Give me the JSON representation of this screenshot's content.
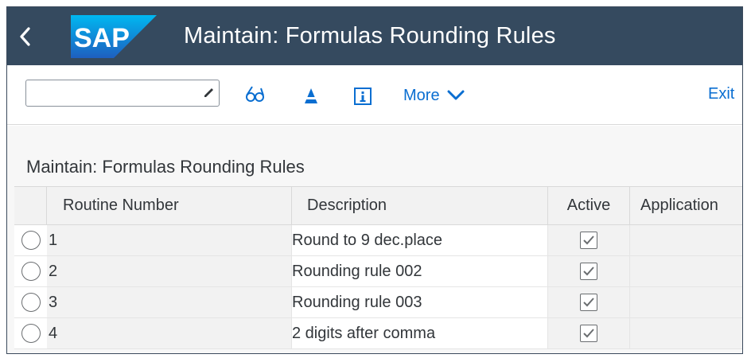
{
  "shell": {
    "title": "Maintain: Formulas Rounding Rules",
    "logo_text": "SAP",
    "back_icon": "chevron-left-icon",
    "colors": {
      "header_bg": "#354a5f",
      "logo_blue": "#1b9ae0"
    }
  },
  "toolbar": {
    "command_field": {
      "value": "",
      "placeholder": ""
    },
    "icons": [
      "glasses-display-icon",
      "triangle-cone-icon",
      "info-icon"
    ],
    "more_label": "More",
    "exit_label": "Exit",
    "accent": "#0a6ed1"
  },
  "section": {
    "title": "Maintain: Formulas Rounding Rules"
  },
  "table": {
    "columns": [
      "Routine Number",
      "Description",
      "Active",
      "Application"
    ],
    "rows": [
      {
        "number": "1",
        "description": "Round to 9 dec.place",
        "active": true,
        "application": ""
      },
      {
        "number": "2",
        "description": "Rounding rule 002",
        "active": true,
        "application": ""
      },
      {
        "number": "3",
        "description": "Rounding rule 003",
        "active": true,
        "application": ""
      },
      {
        "number": "4",
        "description": "2 digits after comma",
        "active": true,
        "application": ""
      }
    ]
  }
}
